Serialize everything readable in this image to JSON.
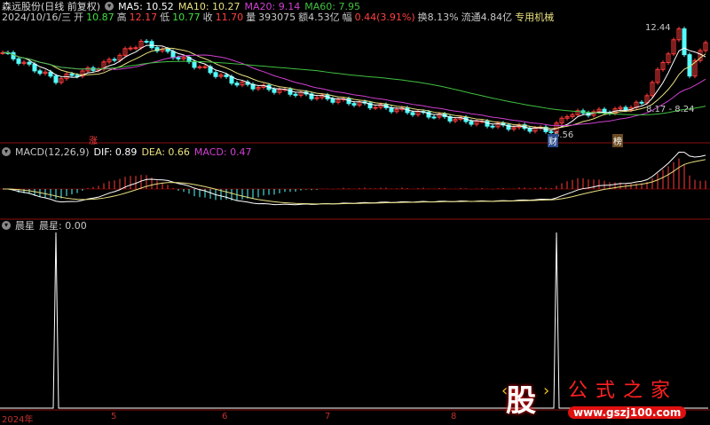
{
  "header": {
    "title": "森远股份(日线 前复权)",
    "ma5": "MA5: 10.52",
    "ma10": "MA10: 10.27",
    "ma20": "MA20: 9.14",
    "ma60": "MA60: 7.95",
    "date": "2024/10/16/三",
    "open_label": "开",
    "open": "10.87",
    "high_label": "高",
    "high": "12.17",
    "low_label": "低",
    "low": "10.77",
    "close_label": "收",
    "close": "11.70",
    "vol_label": "量",
    "vol": "393075",
    "amount": "额4.53亿",
    "chg_label": "幅",
    "chg": "0.44(3.91%)",
    "turnover": "换8.13%",
    "float": "流通4.84亿",
    "sector": "专用机械"
  },
  "annotations": {
    "high": "12.44",
    "low": "6.56",
    "range": "8.17 - 8.24",
    "tag_zhang": "涨",
    "tag_cai": "财",
    "tag_bang": "榜"
  },
  "macd": {
    "title": "MACD(12,26,9)",
    "dif": "DIF: 0.89",
    "dea": "DEA: 0.66",
    "macd": "MACD: 0.47"
  },
  "chenxing": {
    "title": "晨星",
    "label": "晨星: 0.00"
  },
  "axis": {
    "labels": [
      "2024年",
      "5",
      "6",
      "7",
      "8"
    ]
  },
  "logo": {
    "char": "股",
    "name": "公式之家",
    "url": "www.gszj100.com"
  },
  "colors": {
    "up": "#ff3b3b",
    "down": "#54ffff",
    "ma5": "#ffffff",
    "ma10": "#e8e080",
    "ma20": "#d040d0",
    "ma60": "#40c040",
    "grid": "#8a1010"
  },
  "chart_data": {
    "type": "candlestick",
    "price_anchors": [
      [
        0,
        11.0
      ],
      [
        10,
        9.5
      ],
      [
        18,
        10.2
      ],
      [
        26,
        11.6
      ],
      [
        34,
        10.6
      ],
      [
        44,
        9.3
      ],
      [
        58,
        8.6
      ],
      [
        75,
        7.8
      ],
      [
        92,
        7.0
      ],
      [
        103,
        6.7
      ],
      [
        106,
        7.6
      ],
      [
        115,
        7.8
      ],
      [
        120,
        8.2
      ],
      [
        124,
        10.5
      ],
      [
        127,
        12.2
      ],
      [
        129,
        9.8
      ],
      [
        132,
        11.7
      ]
    ],
    "chenxing_signals": [
      10,
      104
    ]
  }
}
